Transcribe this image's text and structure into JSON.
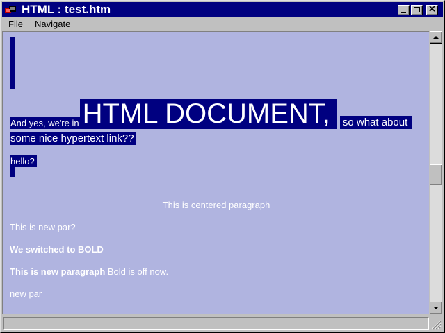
{
  "window": {
    "title": "HTML : test.htm",
    "app_icon": "html-viewer-icon"
  },
  "title_buttons": {
    "minimize": "minimize-icon",
    "maximize": "maximize-icon",
    "close": "close-icon"
  },
  "menu": {
    "file": {
      "mnemonic": "F",
      "rest": "ile"
    },
    "navigate": {
      "mnemonic": "N",
      "rest": "avigate"
    }
  },
  "document": {
    "line1_small": "And yes, we're in",
    "heading": "HTML DOCUMENT,",
    "line1_tail": "so what about",
    "line2": "some nice hypertext link??",
    "line3": "hello?",
    "centered": "This is centered paragraph",
    "new_par": "This is new par?",
    "bold_line": "We switched to BOLD",
    "bold_para_bold": "This is new paragraph",
    "bold_para_normal": " Bold is off now.",
    "last_par": "new par"
  },
  "colors": {
    "titlebar": "#000080",
    "content_background": "#b0b4e0",
    "highlight": "#000080",
    "text": "#ffffff"
  },
  "scrollbar": {
    "up": "scroll-up-arrow-icon",
    "down": "scroll-down-arrow-icon",
    "position_fraction": 0.51
  },
  "status": {
    "text": ""
  }
}
